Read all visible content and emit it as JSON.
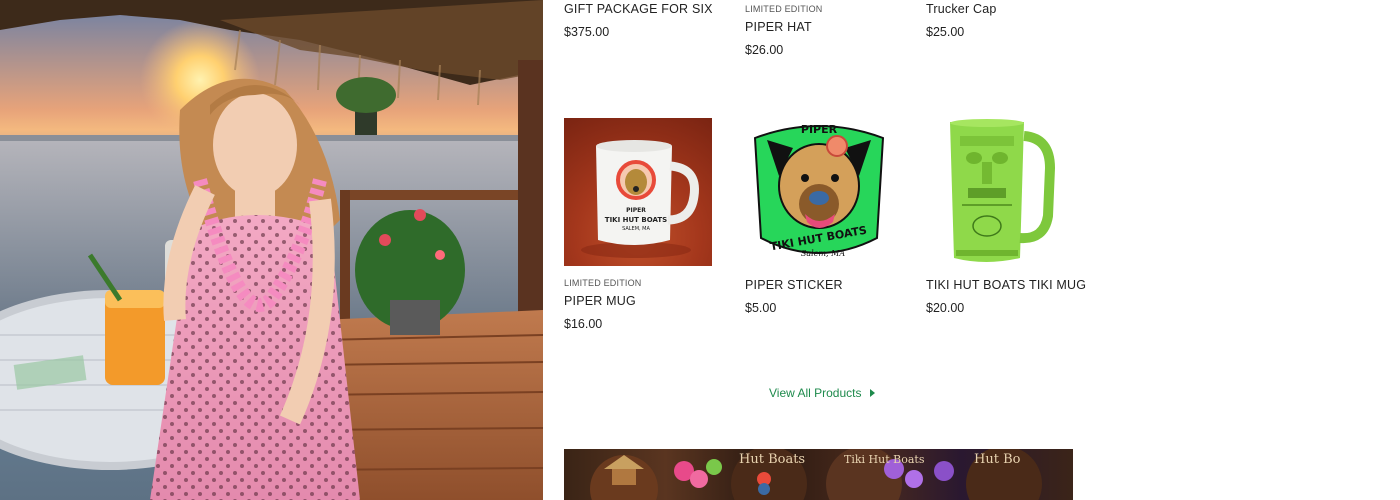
{
  "top_row": [
    {
      "edition": "",
      "title": "GIFT PACKAGE FOR SIX",
      "price": "$375.00"
    },
    {
      "edition": "LIMITED EDITION",
      "title": "PIPER HAT",
      "price": "$26.00"
    },
    {
      "edition": "",
      "title": "Trucker Cap",
      "price": "$25.00"
    }
  ],
  "products": [
    {
      "edition": "LIMITED EDITION",
      "title": "PIPER MUG",
      "price": "$16.00",
      "image_icon": "white-mug-image",
      "mug_text_1": "PIPER",
      "mug_text_2": "TIKI HUT BOATS",
      "mug_text_3": "SALEM, MA"
    },
    {
      "edition": "",
      "title": "PIPER STICKER",
      "price": "$5.00",
      "image_icon": "dog-sticker-image",
      "sticker_text_1": "PIPER",
      "sticker_text_2": "TIKI HUT BOATS",
      "sticker_text_3": "Salem, MA"
    },
    {
      "edition": "",
      "title": "TIKI HUT BOATS TIKI MUG",
      "price": "$20.00",
      "image_icon": "green-tiki-mug-image"
    }
  ],
  "view_all": {
    "label": "View All Products",
    "icon": "caret-right-icon"
  },
  "banner": {
    "text_1": "Hut Boats",
    "text_2": "Tiki Hut Boats",
    "text_3": "Hut Bo"
  },
  "colors": {
    "link": "#1e8a4c",
    "sticker_green": "#27d65a",
    "tiki_green": "#8fd94a"
  }
}
